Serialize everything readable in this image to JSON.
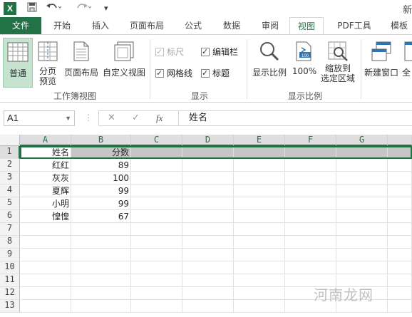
{
  "window": {
    "title_fragment": "新"
  },
  "colors": {
    "accent": "#217346",
    "tab_file_bg": "#217346"
  },
  "tabs": [
    {
      "label": "文件"
    },
    {
      "label": "开始"
    },
    {
      "label": "插入"
    },
    {
      "label": "页面布局"
    },
    {
      "label": "公式"
    },
    {
      "label": "数据"
    },
    {
      "label": "审阅"
    },
    {
      "label": "视图"
    },
    {
      "label": "PDF工具"
    },
    {
      "label": "模板"
    }
  ],
  "active_tab": "视图",
  "ribbon": {
    "workbook_views": {
      "label": "工作簿视图",
      "buttons": [
        {
          "label": "普通",
          "icon": "normal-view-icon",
          "selected": true
        },
        {
          "label": "分页\n预览",
          "line1": "分页",
          "line2": "预览",
          "icon": "page-break-preview-icon"
        },
        {
          "label": "页面布局",
          "icon": "page-layout-icon"
        },
        {
          "label": "自定义视图",
          "icon": "custom-views-icon"
        }
      ]
    },
    "show": {
      "label": "显示",
      "checks": [
        {
          "label": "标尺",
          "checked": true,
          "disabled": true
        },
        {
          "label": "编辑栏",
          "checked": true
        },
        {
          "label": "网格线",
          "checked": true
        },
        {
          "label": "标题",
          "checked": true
        }
      ]
    },
    "zoom": {
      "label": "显示比例",
      "buttons": [
        {
          "label": "显示比例",
          "icon": "zoom-icon"
        },
        {
          "label": "100%",
          "icon": "zoom-100-icon"
        },
        {
          "line1": "缩放到",
          "line2": "选定区域",
          "icon": "zoom-to-selection-icon"
        }
      ]
    },
    "window_group": {
      "buttons": [
        {
          "label": "新建窗口",
          "icon": "new-window-icon"
        },
        {
          "label": "全",
          "icon": "arrange-all-icon"
        }
      ]
    }
  },
  "formula_bar": {
    "name_box": "A1",
    "cancel_symbol": "✕",
    "enter_symbol": "✓",
    "fx_symbol": "fx",
    "content": "姓名"
  },
  "sheet": {
    "columns": [
      "A",
      "B",
      "C",
      "D",
      "E",
      "F",
      "G"
    ],
    "rows": [
      [
        "姓名",
        "分数"
      ],
      [
        "红红",
        "89"
      ],
      [
        "灰灰",
        "100"
      ],
      [
        "夏辉",
        "99"
      ],
      [
        "小明",
        "99"
      ],
      [
        "惶惶",
        "67"
      ],
      [
        "",
        ""
      ],
      [
        "",
        ""
      ],
      [
        "",
        ""
      ],
      [
        "",
        ""
      ],
      [
        "",
        ""
      ],
      [
        "",
        ""
      ],
      [
        "",
        ""
      ]
    ],
    "row_numbers": [
      "1",
      "2",
      "3",
      "4",
      "5",
      "6",
      "7",
      "8",
      "9",
      "10",
      "11",
      "12",
      "13"
    ],
    "selected_row": 1
  },
  "watermark": "河南龙网"
}
